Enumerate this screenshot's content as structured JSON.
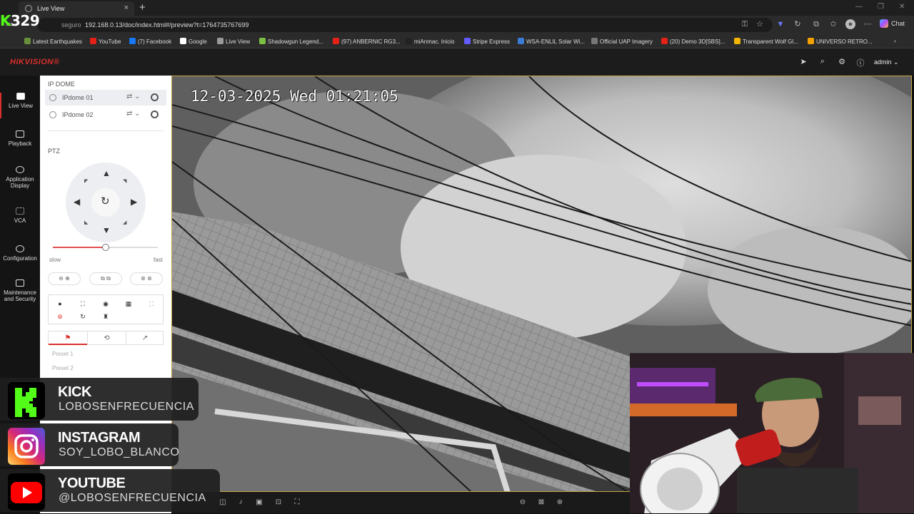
{
  "browser": {
    "tab_title": "Live View",
    "security_label": "seguro",
    "url": "192.168.0.13/doc/index.html#/preview?t=1764735767699",
    "chat_label": "Chat",
    "bookmarks": [
      {
        "label": "Latest Earthquakes",
        "color": "#6a8f3a"
      },
      {
        "label": "YouTube",
        "color": "#e62117"
      },
      {
        "label": "(7) Facebook",
        "color": "#1877f2"
      },
      {
        "label": "Google",
        "color": "#ffffff"
      },
      {
        "label": "Live View",
        "color": "#9a9a9a"
      },
      {
        "label": "Shadowgun Legend...",
        "color": "#7bc043"
      },
      {
        "label": "(97) ANBERNIC RG3...",
        "color": "#e62117"
      },
      {
        "label": "miAnmac. Inicio",
        "color": "#222222"
      },
      {
        "label": "Stripe Express",
        "color": "#635bff"
      },
      {
        "label": "WSA-ENLIL Solar Wi...",
        "color": "#3a7bd5"
      },
      {
        "label": "Official UAP Imagery",
        "color": "#777777"
      },
      {
        "label": "(20) Demo 3D[SBS]...",
        "color": "#e62117"
      },
      {
        "label": "Transparent Wolf Gl...",
        "color": "#f2b400"
      },
      {
        "label": "UNIVERSO RETRO...",
        "color": "#f2a200"
      }
    ]
  },
  "app": {
    "logo": "HIKVISION®",
    "user": "admin"
  },
  "nav": [
    {
      "label": "Live View"
    },
    {
      "label": "Playback"
    },
    {
      "label": "Application Display"
    },
    {
      "label": "VCA"
    },
    {
      "label": "Configuration"
    },
    {
      "label": "Maintenance and Security"
    }
  ],
  "panel": {
    "section_cameras": "IP DOME",
    "cameras": [
      {
        "label": "IPdome 01"
      },
      {
        "label": "IPdome 02"
      }
    ],
    "section_ptz": "PTZ",
    "speed_min": "slow",
    "speed_max": "fast",
    "speed_level": 0.5,
    "presets": [
      "Preset 1",
      "Preset 2"
    ]
  },
  "video": {
    "osd": "12-03-2025 Wed 01:21:05"
  },
  "overlay": {
    "watermark_letter": "K",
    "watermark_number": "329",
    "socials": [
      {
        "name": "KICK",
        "handle": "LOBOSENFRECUENCIA",
        "color": "#53fc18"
      },
      {
        "name": "INSTAGRAM",
        "handle": "SOY_LOBO_BLANCO",
        "color": "#e1306c"
      },
      {
        "name": "YOUTUBE",
        "handle": "@LOBOSENFRECUENCIA",
        "color": "#ff0000"
      }
    ]
  }
}
